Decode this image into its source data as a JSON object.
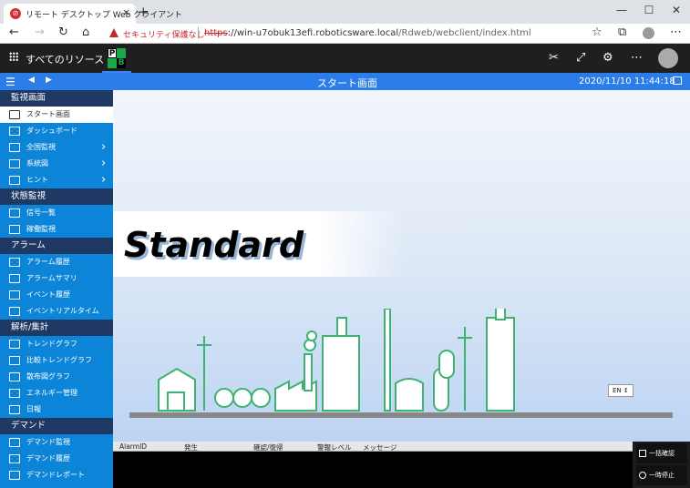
{
  "browser": {
    "tab_title": "リモート デスクトップ Web クライアント",
    "new_tab": "+",
    "close": "×",
    "warning": "セキュリティ保護なし",
    "url_scheme": "https",
    "url_host": "://win-u7obuk13efi.roboticsware.local",
    "url_path": "/Rdweb/webclient/index.html"
  },
  "rdweb": {
    "all_resources": "すべてのリソース"
  },
  "app": {
    "screen_title": "スタート画面",
    "datetime": "2020/11/10 11:44:18",
    "hero_text": "Standard",
    "lang": "EN ↕"
  },
  "sidebar": {
    "sections": [
      {
        "title": "監視画面",
        "items": [
          {
            "label": "スタート画面",
            "active": true
          },
          {
            "label": "ダッシュボード"
          },
          {
            "label": "全国監視",
            "chevron": true
          },
          {
            "label": "系統図",
            "chevron": true
          },
          {
            "label": "ヒント",
            "chevron": true
          }
        ]
      },
      {
        "title": "状態監視",
        "items": [
          {
            "label": "信号一覧"
          },
          {
            "label": "稼働監視"
          }
        ]
      },
      {
        "title": "アラーム",
        "items": [
          {
            "label": "アラーム履歴"
          },
          {
            "label": "アラームサマリ"
          },
          {
            "label": "イベント履歴"
          },
          {
            "label": "イベントリアルタイム"
          }
        ]
      },
      {
        "title": "解析/集計",
        "items": [
          {
            "label": "トレンドグラフ"
          },
          {
            "label": "比較トレンドグラフ"
          },
          {
            "label": "散布図グラフ"
          },
          {
            "label": "エネルギー管理"
          },
          {
            "label": "日報"
          }
        ]
      },
      {
        "title": "デマンド",
        "items": [
          {
            "label": "デマンド監視"
          },
          {
            "label": "デマンド履歴"
          },
          {
            "label": "デマンドレポート"
          }
        ]
      }
    ]
  },
  "alarm": {
    "columns": [
      "AlarmID",
      "発生",
      "確認/復帰",
      "警報レベル",
      "メッセージ"
    ],
    "ack_all": "一括確認",
    "pause": "一時停止"
  },
  "colors": {
    "accent": "#2b7de9",
    "sidebar": "#0c85d8",
    "section": "#1f3864",
    "buildings": "#3cb371"
  }
}
